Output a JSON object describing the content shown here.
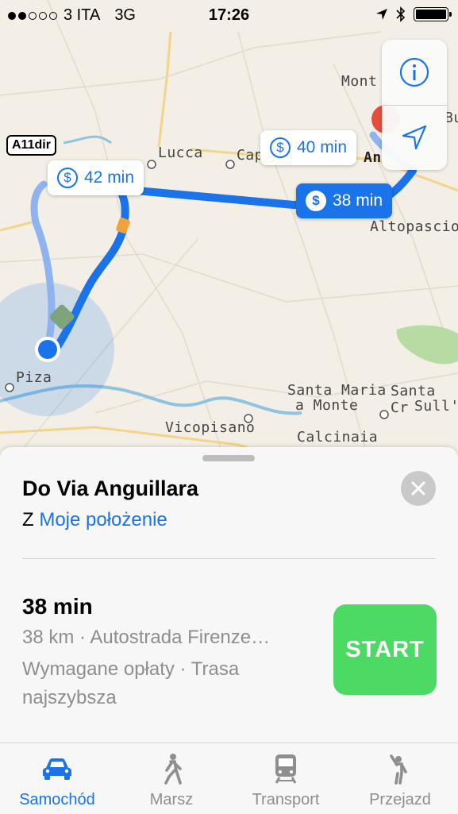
{
  "status_bar": {
    "carrier": "3 ITA",
    "network": "3G",
    "time": "17:26"
  },
  "map": {
    "labels": {
      "lucca": "Lucca",
      "capannori": "Cap",
      "montecarlo": "Mont",
      "altopascio": "Altopascio",
      "piza": "Piza",
      "santa_maria": "Santa Maria",
      "a_monte": "a Monte",
      "santa_croce": "Santa Cr",
      "sullarno": "Sull'a",
      "vicopisano": "Vicopisano",
      "calcinaia": "Calcinaia",
      "bu": "Bu",
      "an": "An"
    },
    "road_tag": "A11dir",
    "route_badges": [
      {
        "label": "42 min",
        "style": "white"
      },
      {
        "label": "40 min",
        "style": "white"
      },
      {
        "label": "38 min",
        "style": "blue"
      }
    ],
    "toll_symbol": "$",
    "colors": {
      "route_primary": "#1a73e8",
      "route_alt": "#8fb3ee",
      "destination_pin": "#e74c3c",
      "user_location": "#1a73e8"
    }
  },
  "controls": {
    "info_icon": "info-icon",
    "location_icon": "location-arrow-icon"
  },
  "sheet": {
    "destination": "Do Via Anguillara",
    "from_prefix": "Z",
    "from_link": "Moje położenie",
    "route_time": "38 min",
    "route_distance": "38 km · Autostrada Firenze…",
    "route_note": "Wymagane opłaty · Trasa najszybsza",
    "start_label": "START"
  },
  "tabs": [
    {
      "label": "Samochód",
      "icon": "car-icon",
      "active": true
    },
    {
      "label": "Marsz",
      "icon": "walk-icon",
      "active": false
    },
    {
      "label": "Transport",
      "icon": "train-icon",
      "active": false
    },
    {
      "label": "Przejazd",
      "icon": "rideshare-icon",
      "active": false
    }
  ]
}
